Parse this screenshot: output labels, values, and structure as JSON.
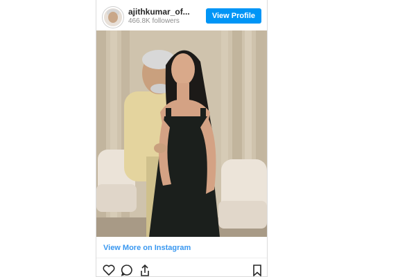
{
  "post": {
    "username": "ajithkumar_of...",
    "followers": "466.8K followers",
    "view_profile_label": "View Profile",
    "view_more_label": "View More on Instagram"
  },
  "icons": {
    "avatar": "avatar-icon",
    "like": "heart-icon",
    "comment": "comment-icon",
    "share": "share-icon",
    "save": "bookmark-icon"
  },
  "colors": {
    "accent": "#0095f6",
    "link": "#3897f0",
    "text": "#262626",
    "muted": "#8e8e8e"
  }
}
